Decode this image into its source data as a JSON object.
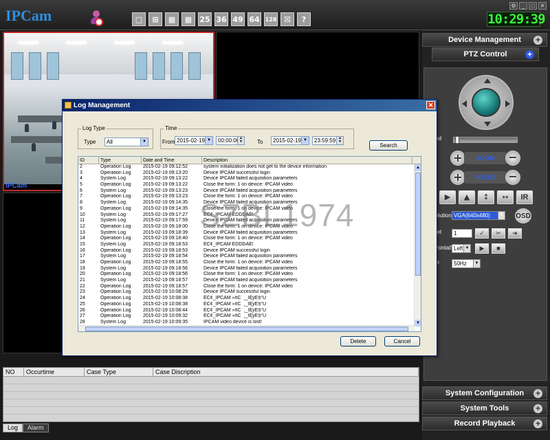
{
  "app": {
    "logo": "IPCam",
    "clock": "10:29:39"
  },
  "toolbar": {
    "layout_labels": [
      "",
      "",
      "",
      "",
      "25",
      "36",
      "49",
      "64",
      "128",
      "",
      "?"
    ]
  },
  "video": {
    "cam_label": "IPCam"
  },
  "events": {
    "columns": [
      "NO",
      "Occurtime",
      "Case Type",
      "Case Discription"
    ],
    "tabs": [
      "Log",
      "Alarm"
    ]
  },
  "right_panel": {
    "device_management": "Device Management",
    "ptz_control": "PTZ Control",
    "speed_label": "Speed",
    "zoom_label": "ZOOM",
    "focus_label": "FOCUS",
    "ir_label": "IR",
    "resolution_label": "Resolution",
    "resolution_value": "VGA(640x480)",
    "osd_label": "OSD",
    "preset_label": "Preset",
    "preset_value": "1",
    "horizontal_label": "HorizontalS",
    "horizontal_value": "Left",
    "mode_label": "Mode",
    "mode_value": "50Hz",
    "system_configuration": "System Configuration",
    "system_tools": "System Tools",
    "record_playback": "Record Playback"
  },
  "dialog": {
    "title": "Log Management",
    "log_type_legend": "Log Type",
    "type_label": "Type",
    "type_value": "All",
    "time_legend": "Time",
    "from_label": "From",
    "from_date": "2015-02-19",
    "from_time": "00:00:00",
    "to_label": "To",
    "to_date": "2015-02-19",
    "to_time": "23:59:59",
    "search_button": "Search",
    "delete_button": "Delete",
    "cancel_button": "Cancel",
    "columns": [
      "ID",
      "Type",
      "Date and Time",
      "Description"
    ],
    "rows": [
      [
        "2",
        "Operation Log",
        "2015-02-19 09:12:52",
        "system initialization does not get to the device information"
      ],
      [
        "3",
        "Operation Log",
        "2015-02-19 09:13:20",
        "Device IPCAM successful login"
      ],
      [
        "4",
        "System Log",
        "2015-02-19 09:13:22",
        "Device IPCAM failed acquisition parameters"
      ],
      [
        "5",
        "Operation Log",
        "2015-02-19 09:13:22",
        "Close the form: 1 on device: IPCAM video"
      ],
      [
        "6",
        "System Log",
        "2015-02-19 09:13:23",
        "Device IPCAM failed acquisition parameters"
      ],
      [
        "7",
        "Operation Log",
        "2015-02-19 09:13:23",
        "Close the form: 1 on device: IPCAM video"
      ],
      [
        "8",
        "System Log",
        "2015-02-19 09:14:35",
        "Device IPCAM failed acquisition parameters"
      ],
      [
        "9",
        "Operation Log",
        "2015-02-19 09:14:35",
        "Close the form: 1 on device: IPCAM video"
      ],
      [
        "10",
        "System Log",
        "2015-02-19 09:17:27",
        "ÉĈ¢_IPCAM ÊĎĎĎÄÊ!"
      ],
      [
        "11",
        "System Log",
        "2015-02-19 09:17:59",
        "Device IPCAM failed acquisition parameters"
      ],
      [
        "12",
        "Operation Log",
        "2015-02-19 09:18:00",
        "Close the form: 1 on device: IPCAM video"
      ],
      [
        "13",
        "System Log",
        "2015-02-19 09:18:39",
        "Device IPCAM failed acquisition parameters"
      ],
      [
        "14",
        "Operation Log",
        "2015-02-19 09:18:40",
        "Close the form: 1 on device: IPCAM video"
      ],
      [
        "15",
        "System Log",
        "2015-02-19 09:18:53",
        "ÉĈ¢_IPCAM ÊĎĎĎÄÊ!"
      ],
      [
        "16",
        "Operation Log",
        "2015-02-19 09:18:53",
        "Device IPCAM successful login"
      ],
      [
        "17",
        "System Log",
        "2015-02-19 09:18:54",
        "Device IPCAM failed acquisition parameters"
      ],
      [
        "18",
        "Operation Log",
        "2015-02-19 09:18:55",
        "Close the form: 1 on device: IPCAM video"
      ],
      [
        "19",
        "System Log",
        "2015-02-19 09:18:56",
        "Device IPCAM failed acquisition parameters"
      ],
      [
        "20",
        "Operation Log",
        "2015-02-19 09:18:56",
        "Close the form: 1 on device: IPCAM video"
      ],
      [
        "21",
        "System Log",
        "2015-02-19 09:18:57",
        "Device IPCAM failed acquisition parameters"
      ],
      [
        "22",
        "Operation Log",
        "2015-02-19 09:18:57",
        "Close the form: 1 on device: IPCAM video"
      ],
      [
        "23",
        "Operation Log",
        "2015-02-19 10:08:29",
        "Device IPCAM successful login"
      ],
      [
        "24",
        "Operation Log",
        "2015-02-19 10:08:38",
        "ÉĈ¢_IPCAM »ñĈ¯¸_ÎĘýÈ§°Ü"
      ],
      [
        "25",
        "Operation Log",
        "2015-02-19 10:08:38",
        "ÉĈ¢_IPCAM »ñĈ¯¸_ÎĘýÈ§°Ü"
      ],
      [
        "26",
        "Operation Log",
        "2015-02-19 10:08:44",
        "ÉĈ¢_IPCAM »ñĈ¯¸_ÎĘýÈ§°Ü"
      ],
      [
        "27",
        "Operation Log",
        "2015-02-19 10:09:32",
        "ÉĈ¢_IPCAM »ñĈ¯¸_ÎĘýÈ§°Ü"
      ],
      [
        "28",
        "System Log",
        "2015-02-19 10:09:35",
        "IPCAM video device is lost!"
      ]
    ]
  },
  "watermark": "SZBL1974",
  "colors": {
    "accent": "#2f8fe0",
    "clock": "#3cf03c",
    "active_pane": "#c42525",
    "dialog_title": "#0a246a"
  }
}
